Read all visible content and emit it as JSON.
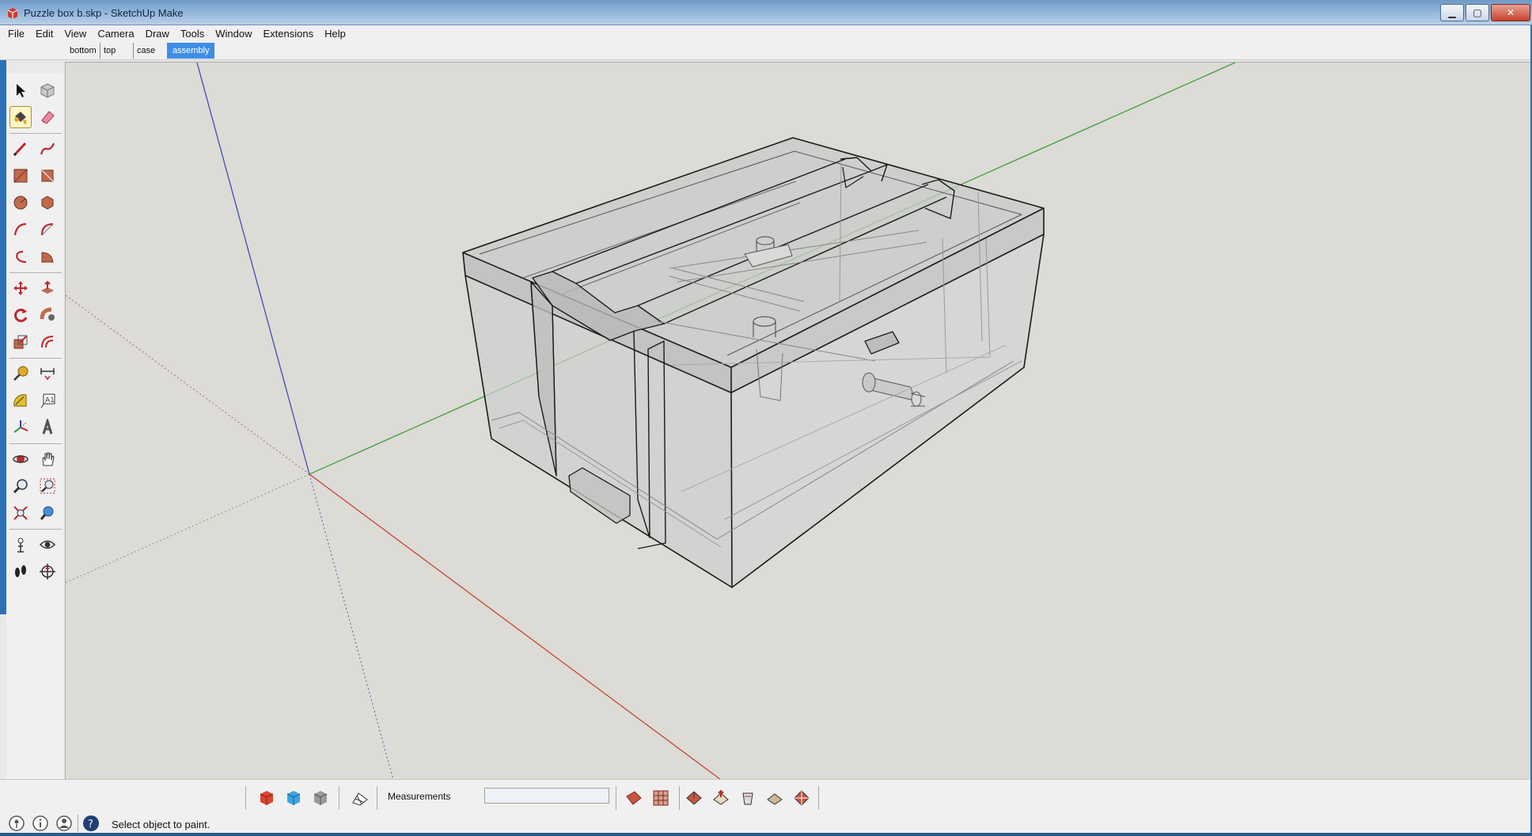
{
  "window": {
    "title": "Puzzle box b.skp - SketchUp Make",
    "buttons": {
      "minimize": "▁",
      "maximize": "▢",
      "close": "✕"
    }
  },
  "menu": [
    "File",
    "Edit",
    "View",
    "Camera",
    "Draw",
    "Tools",
    "Window",
    "Extensions",
    "Help"
  ],
  "scenes": {
    "tabs": [
      "bottom",
      "top",
      "case",
      "assembly"
    ],
    "active": "assembly"
  },
  "toolbar_left": [
    "select-arrow-icon",
    "make-component-icon",
    "paint-bucket-icon",
    "eraser-icon",
    "line-pencil-icon",
    "freehand-icon",
    "rectangle-icon",
    "rotated-rectangle-icon",
    "circle-icon",
    "polygon-icon",
    "arc-icon",
    "two-point-arc-icon",
    "three-point-arc-icon",
    "pie-icon",
    "move-icon",
    "push-pull-icon",
    "rotate-icon",
    "follow-me-icon",
    "scale-icon",
    "offset-icon",
    "tape-measure-icon",
    "dimension-icon",
    "protractor-icon",
    "text-icon",
    "axes-icon",
    "3d-text-icon",
    "orbit-icon",
    "pan-icon",
    "zoom-icon",
    "zoom-window-icon",
    "zoom-extents-icon",
    "previous-view-icon",
    "position-camera-icon",
    "look-around-icon",
    "walk-icon",
    "section-plane-icon"
  ],
  "bottom_toolbar": {
    "left_tools": [
      "red-cube-icon",
      "blue-cube-icon",
      "gray-cube-icon",
      "sandbox-icon"
    ],
    "measurements_label": "Measurements",
    "measurements_value": "",
    "right_tools": [
      "add-location-icon",
      "toggle-terrain-icon",
      "photo-textures-icon",
      "share-model-icon",
      "get-models-icon",
      "share-component-icon",
      "extension-warehouse-icon"
    ]
  },
  "status": {
    "icons": [
      "geo-location-icon",
      "credits-icon",
      "user-icon",
      "help-icon"
    ],
    "text": "Select object to paint."
  },
  "colors": {
    "viewport_bg": "#dcdbd6",
    "axis_red": "#c43a2f",
    "axis_green": "#2f9a2f",
    "axis_blue": "#3a3fb5",
    "active_tab": "#3e8ee6"
  }
}
